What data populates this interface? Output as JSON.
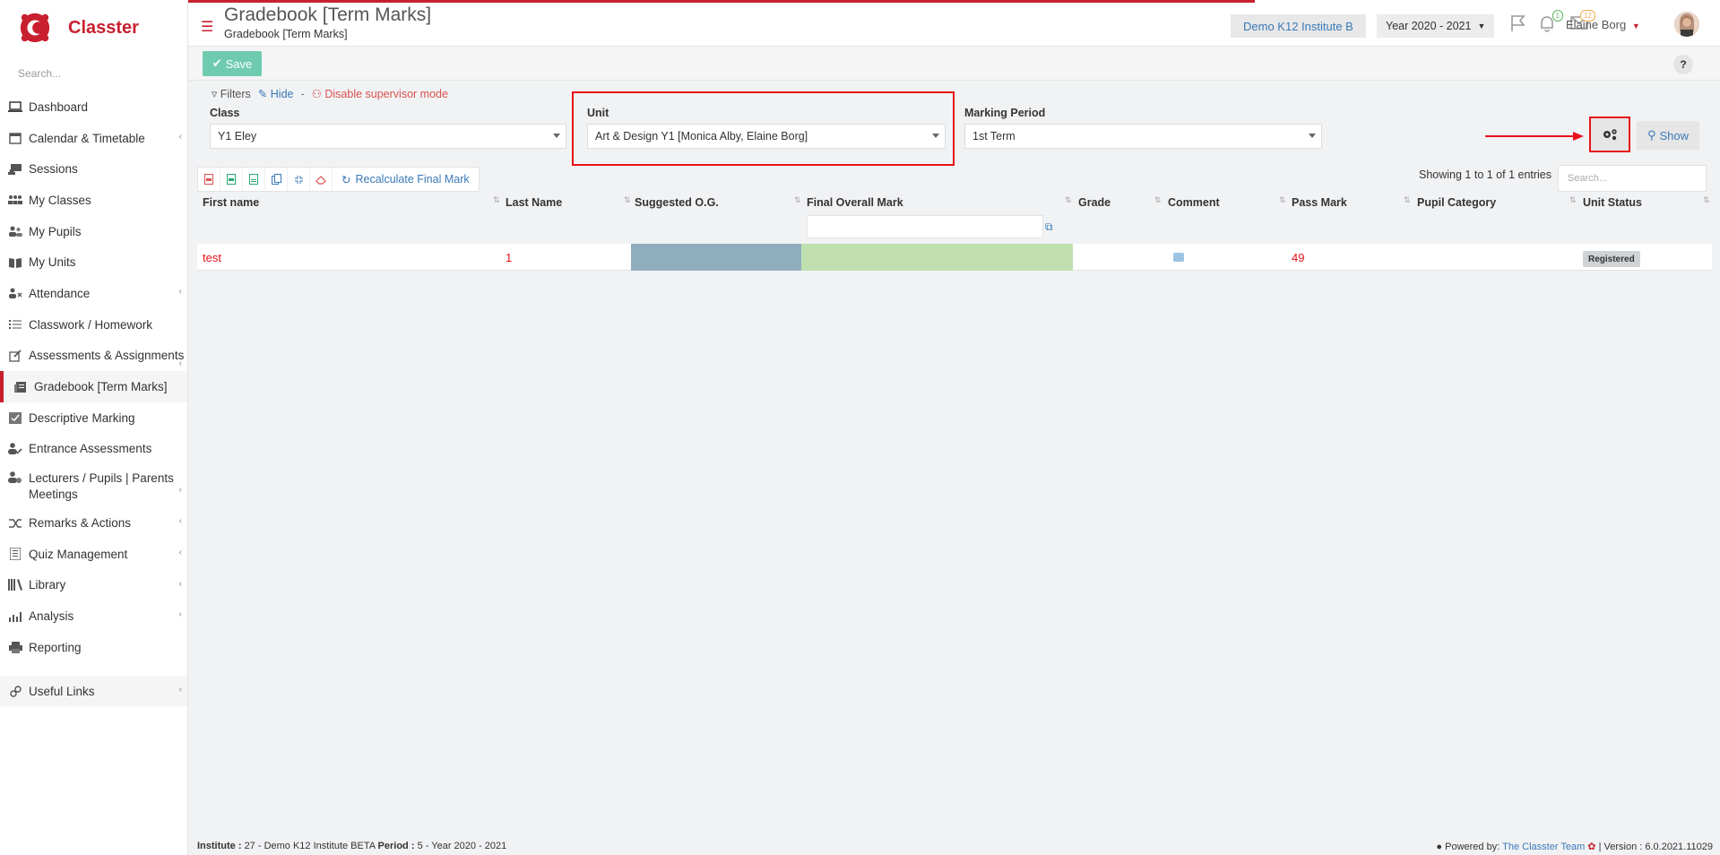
{
  "app": {
    "name": "Classter"
  },
  "sidebar": {
    "search_placeholder": "Search...",
    "items": [
      {
        "label": "Dashboard",
        "icon": "laptop-icon"
      },
      {
        "label": "Calendar & Timetable",
        "icon": "calendar-icon"
      },
      {
        "label": "Sessions",
        "icon": "sessions-icon"
      },
      {
        "label": "My Classes",
        "icon": "classes-icon"
      },
      {
        "label": "My Pupils",
        "icon": "pupils-icon"
      },
      {
        "label": "My Units",
        "icon": "book-icon"
      },
      {
        "label": "Attendance",
        "icon": "attendance-icon"
      },
      {
        "label": "Classwork / Homework",
        "icon": "list-icon"
      },
      {
        "label": "Assessments & Assignments",
        "icon": "edit-icon"
      },
      {
        "label": "Gradebook [Term Marks]",
        "icon": "gradebook-icon"
      },
      {
        "label": "Descriptive Marking",
        "icon": "marking-icon"
      },
      {
        "label": "Entrance Assessments",
        "icon": "user-edit-icon"
      },
      {
        "label": "Lecturers / Pupils | Parents Meetings",
        "icon": "meetings-icon"
      },
      {
        "label": "Remarks & Actions",
        "icon": "shuffle-icon"
      },
      {
        "label": "Quiz Management",
        "icon": "quiz-icon"
      },
      {
        "label": "Library",
        "icon": "library-icon"
      },
      {
        "label": "Analysis",
        "icon": "analysis-icon"
      },
      {
        "label": "Reporting",
        "icon": "print-icon"
      }
    ],
    "useful_links": "Useful Links"
  },
  "header": {
    "title": "Gradebook [Term Marks]",
    "subtitle": "Gradebook [Term Marks]",
    "institute": "Demo K12 Institute B",
    "year": "Year 2020 - 2021",
    "notifications_count": "1",
    "messages_count": "12",
    "user_name": "Elaine Borg"
  },
  "toolbar": {
    "save_label": "Save",
    "help_label": "?"
  },
  "filters": {
    "filters_label": "Filters",
    "hide_label": "Hide",
    "separator": "-",
    "supervisor_label": "Disable supervisor mode",
    "class_label": "Class",
    "class_value": "Y1 Eley",
    "unit_label": "Unit",
    "unit_value": "Art & Design Y1 [Monica Alby, Elaine Borg]",
    "period_label": "Marking Period",
    "period_value": "1st Term",
    "show_label": "Show"
  },
  "table": {
    "recalc_label": "Recalculate Final Mark",
    "entries_info": "Showing 1 to 1 of 1 entries",
    "search_placeholder": "Search...",
    "columns": [
      "First name",
      "Last Name",
      "Suggested O.G.",
      "Final Overall Mark",
      "Grade",
      "Comment",
      "Pass Mark",
      "Pupil Category",
      "Unit Status"
    ],
    "rows": [
      {
        "first_name": "test",
        "last_name": "1",
        "suggested_og": "",
        "final_mark": "",
        "grade": "",
        "pass_mark": "49",
        "category": "",
        "status": "Registered"
      }
    ]
  },
  "footer": {
    "institute_label": "Institute :",
    "institute_value": "27 - Demo K12 Institute BETA",
    "period_label": "Period :",
    "period_value": "5 - Year 2020 - 2021",
    "powered_label": "Powered by:",
    "powered_value": "The Classter Team",
    "version": "| Version : 6.0.2021.11029"
  },
  "colors": {
    "brand": "#c8202f",
    "link": "#3a79b8",
    "save": "#6fcbb0",
    "highlight": "#e8121a",
    "og_cell": "#8fadbf",
    "final_cell": "#bfdfae"
  }
}
